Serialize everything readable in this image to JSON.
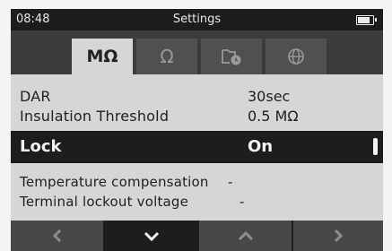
{
  "status": {
    "time": "08:48",
    "title": "Settings"
  },
  "tabs": [
    {
      "label": "MΩ",
      "active": true
    },
    {
      "label": "Ω",
      "active": false
    },
    {
      "label": "",
      "icon": "timer-icon",
      "active": false
    },
    {
      "label": "",
      "icon": "globe-icon",
      "active": false
    }
  ],
  "settings": {
    "dar": {
      "label": "DAR",
      "value": "30sec"
    },
    "threshold": {
      "label": "Insulation Threshold",
      "value": "0.5 MΩ"
    },
    "lock": {
      "label": "Lock",
      "value": "On"
    },
    "temperature": {
      "label": "Temperature compensation",
      "value": "-"
    },
    "terminal": {
      "label": "Terminal lockout voltage",
      "value": "-"
    }
  },
  "nav": [
    {
      "icon": "chevron-left-icon"
    },
    {
      "icon": "chevron-down-icon",
      "active": true
    },
    {
      "icon": "chevron-up-icon"
    },
    {
      "icon": "chevron-right-icon"
    }
  ],
  "colors": {
    "bar": "#1d1d1f",
    "panel": "#d6d6d6",
    "tab_inactive": "#505052",
    "nav_button": "#48484a"
  }
}
